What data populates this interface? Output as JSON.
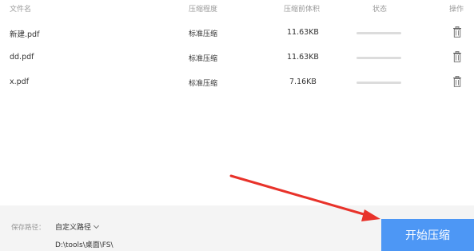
{
  "header": {
    "col_name": "文件名",
    "col_level": "压缩程度",
    "col_size": "压缩前体积",
    "col_status": "状态",
    "col_action": "操作"
  },
  "files": [
    {
      "name": "新建.pdf",
      "level": "标准压缩",
      "size": "11.63KB",
      "progress": 0
    },
    {
      "name": "dd.pdf",
      "level": "标准压缩",
      "size": "11.63KB",
      "progress": 0
    },
    {
      "name": "x.pdf",
      "level": "标准压缩",
      "size": "7.16KB",
      "progress": 0
    }
  ],
  "footer": {
    "save_label": "保存路径：",
    "path_option": "自定义路径",
    "path": "D:\\tools\\桌面\\FS\\",
    "start_button": "开始压缩"
  },
  "colors": {
    "accent": "#4d97f5",
    "arrow": "#e8322a",
    "footer_bg": "#f4f4f4"
  },
  "icons": {
    "delete": "trash-icon",
    "dropdown": "chevron-down-icon"
  }
}
